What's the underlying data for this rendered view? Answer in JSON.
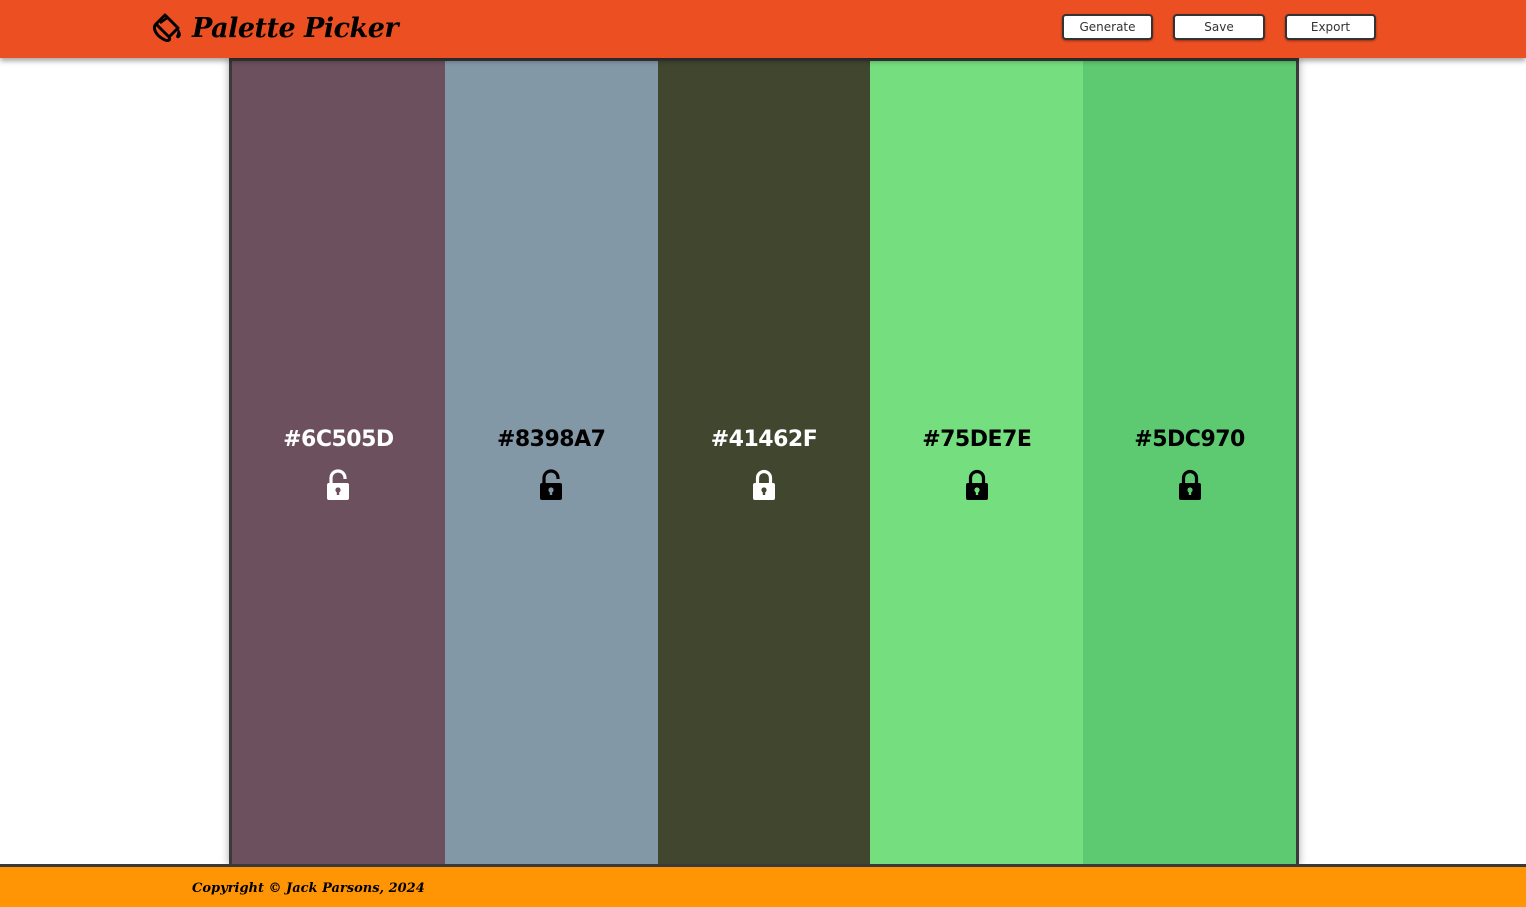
{
  "header": {
    "brand_icon": "paint-bucket-icon",
    "title": "Palette Picker",
    "buttons": {
      "generate": "Generate",
      "save": "Save",
      "export": "Export"
    },
    "background": "#ec5022"
  },
  "palette": {
    "swatches": [
      {
        "hex": "#6C505D",
        "color": "#6C505D",
        "text_tone": "light",
        "locked": false
      },
      {
        "hex": "#8398A7",
        "color": "#8398A7",
        "text_tone": "dark",
        "locked": false
      },
      {
        "hex": "#41462F",
        "color": "#41462F",
        "text_tone": "light",
        "locked": true
      },
      {
        "hex": "#75DE7E",
        "color": "#75DE7E",
        "text_tone": "dark",
        "locked": true
      },
      {
        "hex": "#5DC970",
        "color": "#5DC970",
        "text_tone": "dark",
        "locked": true
      }
    ]
  },
  "footer": {
    "copyright": "Copyright © Jack Parsons, 2024",
    "background": "#ff9505"
  }
}
